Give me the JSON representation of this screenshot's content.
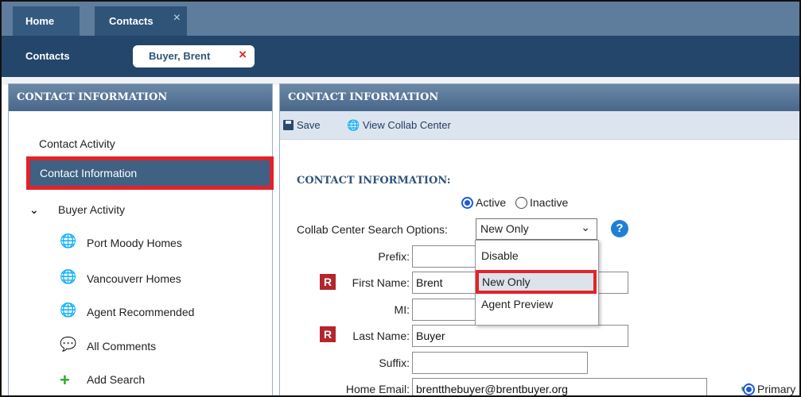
{
  "tabs": [
    {
      "label": "Home"
    },
    {
      "label": "Contacts",
      "close": "×"
    }
  ],
  "subbar": {
    "label": "Contacts",
    "record_chip": {
      "label": "Buyer, Brent",
      "close": "×"
    }
  },
  "left_panel": {
    "header": "CONTACT INFORMATION",
    "items": [
      {
        "label": "Contact Activity"
      },
      {
        "label": "Contact Information",
        "selected": true
      },
      {
        "label": "Buyer Activity",
        "expanded": true
      }
    ],
    "sub_items": [
      {
        "label": "Port Moody Homes",
        "icon": "globe-icon"
      },
      {
        "label": "Vancouverr Homes",
        "icon": "globe-icon"
      },
      {
        "label": "Agent Recommended",
        "icon": "globe-icon"
      },
      {
        "label": "All Comments",
        "icon": "comment-icon"
      },
      {
        "label": "Add Search",
        "icon": "plus-icon"
      }
    ]
  },
  "right_panel": {
    "header": "CONTACT INFORMATION",
    "toolbar": {
      "save_label": "Save",
      "collab_label": "View Collab Center"
    },
    "section_title": "CONTACT INFORMATION:",
    "status": {
      "active_label": "Active",
      "inactive_label": "Inactive",
      "selected": "Active"
    },
    "collab_search": {
      "label": "Collab Center Search Options:",
      "value": "New Only",
      "options": [
        "Disable",
        "New Only",
        "Agent Preview"
      ],
      "highlighted": "New Only"
    },
    "fields": {
      "prefix": {
        "label": "Prefix:",
        "value": ""
      },
      "first_name": {
        "label": "First Name:",
        "value": "Brent",
        "required_badge": "R"
      },
      "mi": {
        "label": "MI:",
        "value": ""
      },
      "last_name": {
        "label": "Last Name:",
        "value": "Buyer",
        "required_badge": "R"
      },
      "suffix": {
        "label": "Suffix:",
        "value": ""
      },
      "home_email": {
        "label": "Home Email:",
        "value": "brentthebuyer@brentbuyer.org",
        "primary_label": "Primary"
      }
    }
  },
  "colors": {
    "accent_red": "#e1232a",
    "header_blue": "#24466b",
    "selected_blue": "#3e6184"
  }
}
